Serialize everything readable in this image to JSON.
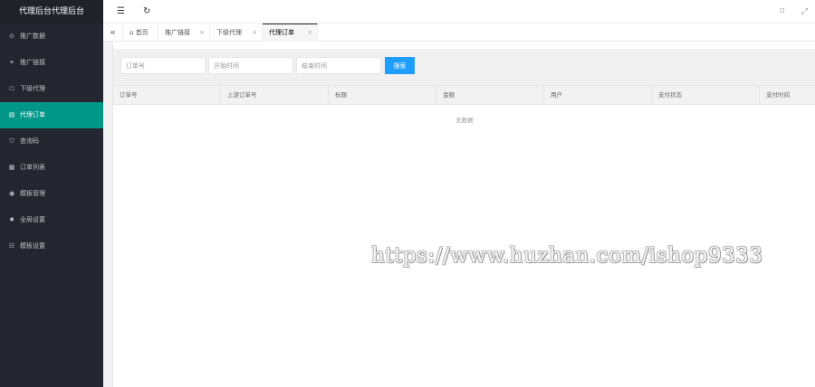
{
  "app": {
    "title": "代理后台代理后台"
  },
  "sidebar": {
    "items": [
      {
        "label": "推广数据",
        "icon": "circle-dot-icon",
        "glyph": "⊙",
        "active": false
      },
      {
        "label": "推广链接",
        "icon": "link-icon",
        "glyph": "⚭",
        "active": false
      },
      {
        "label": "下级代理",
        "icon": "user-icon",
        "glyph": "☖",
        "active": false
      },
      {
        "label": "代理订单",
        "icon": "order-icon",
        "glyph": "▤",
        "active": true
      },
      {
        "label": "查询码",
        "icon": "shield-icon",
        "glyph": "⛉",
        "active": false
      },
      {
        "label": "订单列表",
        "icon": "list-icon",
        "glyph": "▦",
        "active": false
      },
      {
        "label": "模板管理",
        "icon": "template-icon",
        "glyph": "◉",
        "active": false
      },
      {
        "label": "全局设置",
        "icon": "gear-icon",
        "glyph": "✹",
        "active": false
      },
      {
        "label": "模板设置",
        "icon": "sliders-icon",
        "glyph": "☷",
        "active": false
      }
    ]
  },
  "header": {
    "menu_icon": "☰",
    "refresh_icon": "↻",
    "tag_icon": "⌑",
    "fullscreen_icon": "⤢"
  },
  "tabs": {
    "collapse_icon": "«",
    "items": [
      {
        "label": "首页",
        "home_glyph": "⌂",
        "closable": false,
        "active": false
      },
      {
        "label": "推广链接",
        "closable": true,
        "active": false
      },
      {
        "label": "下级代理",
        "closable": true,
        "active": false
      },
      {
        "label": "代理订单",
        "closable": true,
        "active": true
      }
    ],
    "close_glyph": "×"
  },
  "search": {
    "order_no_placeholder": "订单号",
    "start_time_placeholder": "开始时间",
    "end_time_placeholder": "结束时间",
    "button_label": "搜索"
  },
  "table": {
    "columns": [
      "订单号",
      "上游订单号",
      "标题",
      "金额",
      "用户",
      "支付状态",
      "支付时间"
    ],
    "rows": [],
    "empty_text": "无数据"
  },
  "watermark": {
    "text": "https://www.huzhan.com/ishop9333"
  }
}
